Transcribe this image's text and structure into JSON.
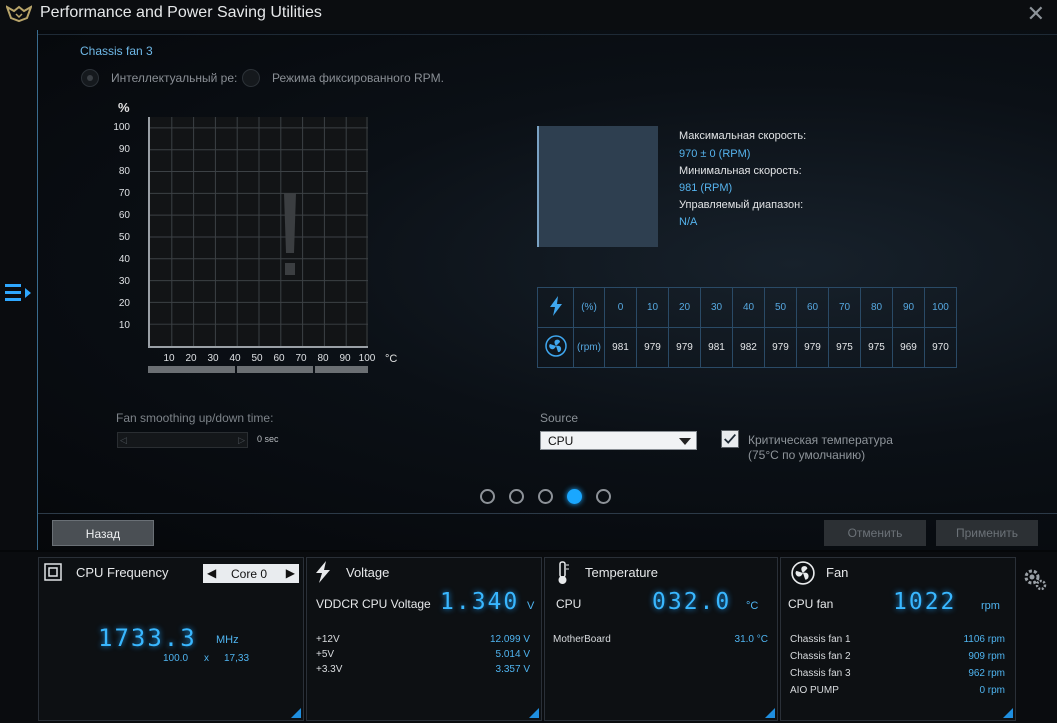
{
  "window": {
    "title": "Performance and Power Saving Utilities",
    "close": "✕"
  },
  "fan": {
    "name": "Chassis fan 3",
    "mode_smart": "Интеллектуальный ре:",
    "mode_fixed": "Режима фиксированного RPM.",
    "y_axis_unit": "%",
    "x_axis_unit": "°C",
    "y_ticks": [
      "100",
      "90",
      "80",
      "70",
      "60",
      "50",
      "40",
      "30",
      "20",
      "10"
    ],
    "x_ticks": [
      "10",
      "20",
      "30",
      "40",
      "50",
      "60",
      "70",
      "80",
      "90",
      "100"
    ],
    "warning_glyph": "!",
    "max_speed_label": "Максимальная скорость:",
    "max_speed_value": "970 ± 0 (RPM)",
    "min_speed_label": "Минимальная скорость:",
    "min_speed_value": "981 (RPM)",
    "range_label": "Управляемый диапазон:",
    "range_value": "N/A",
    "table": {
      "pct_unit": "(%)",
      "rpm_unit": "(rpm)",
      "pct": [
        "0",
        "10",
        "20",
        "30",
        "40",
        "50",
        "60",
        "70",
        "80",
        "90",
        "100"
      ],
      "rpm": [
        "981",
        "979",
        "979",
        "981",
        "982",
        "979",
        "979",
        "975",
        "975",
        "969",
        "970"
      ]
    },
    "smoothing_label": "Fan smoothing up/down time:",
    "smoothing_value": "0 sec",
    "slider_left": "◁",
    "slider_right": "▷",
    "source_label": "Source",
    "source_value": "CPU",
    "critical_line1": "Критическая температура",
    "critical_line2": "(75°C по умолчанию)",
    "critical_checked": true,
    "page_count": 5,
    "active_page": 4
  },
  "buttons": {
    "back": "Назад",
    "cancel": "Отменить",
    "apply": "Применить"
  },
  "monitor": {
    "cpu": {
      "title": "CPU Frequency",
      "core": "Core 0",
      "prev": "◀",
      "next": "▶",
      "freq": "1733.3",
      "unit": "MHz",
      "bclk": "100.0",
      "x": "x",
      "ratio": "17,33"
    },
    "voltage": {
      "title": "Voltage",
      "main_label": "VDDCR CPU Voltage",
      "main_value": "1.340",
      "main_unit": "V",
      "rows": [
        {
          "label": "+12V",
          "value": "12.099  V"
        },
        {
          "label": "+5V",
          "value": "5.014  V"
        },
        {
          "label": "+3.3V",
          "value": "3.357  V"
        }
      ]
    },
    "temperature": {
      "title": "Temperature",
      "main_label": "CPU",
      "main_value": "032.0",
      "main_unit": "°C",
      "rows": [
        {
          "label": "MotherBoard",
          "value": "31.0 °C"
        }
      ]
    },
    "fan": {
      "title": "Fan",
      "main_label": "CPU fan",
      "main_value": "1022",
      "main_unit": "rpm",
      "rows": [
        {
          "label": "Chassis fan 1",
          "value": "1106  rpm"
        },
        {
          "label": "Chassis fan 2",
          "value": "909  rpm"
        },
        {
          "label": "Chassis fan 3",
          "value": "962  rpm"
        },
        {
          "label": "AIO PUMP",
          "value": "0  rpm"
        }
      ]
    }
  },
  "colors": {
    "accent": "#1aa7ff",
    "label_blue": "#56b4ee",
    "digits": "#39b7ff"
  },
  "icons": {
    "logo": "tuf-logo-icon",
    "menu": "menu-toggle-icon",
    "cpu": "cpu-chip-icon",
    "voltage": "lightning-icon",
    "temperature": "thermometer-icon",
    "fan": "fan-icon",
    "settings": "gear-icon"
  }
}
